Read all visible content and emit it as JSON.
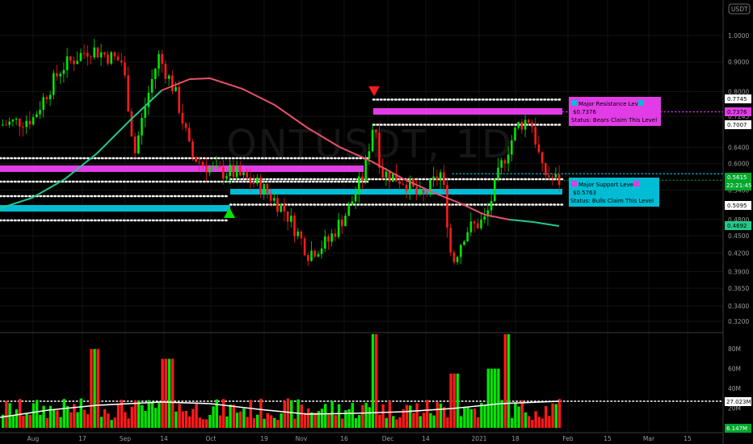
{
  "chart": {
    "currency": "USDT",
    "watermark": "ONTUSDT, 1D",
    "colors": {
      "up": "#00e600",
      "down": "#ff1a1a",
      "ma_up": "#22c98b",
      "ma_down": "#e8506a",
      "resistance": "#e23ce6",
      "support": "#00bcd4",
      "volume_avg": "#ffffff"
    },
    "resistance_box": {
      "title": "Major Resistance Level",
      "price": "$0.7376",
      "status": "Status: Bears Claim This Level"
    },
    "support_box": {
      "title": "Major Support Level",
      "price": "$0.5763",
      "status": "Status: Bulls Claim This Level"
    },
    "tags": {
      "r_top": "0.7745",
      "r_mid": "0.7376",
      "r_bot": "0.7007",
      "price": "0.5615",
      "countdown": "22:21:45",
      "s_bot": "0.5095",
      "ma": "0.4692",
      "vol_avg": "27.023M",
      "vol_last": "6.147M"
    }
  },
  "chart_data": {
    "type": "candlestick",
    "title": "",
    "price_axis": {
      "scale": "log",
      "ticks": [
        "1.0000",
        "0.9000",
        "0.8000",
        "0.7245",
        "0.6400",
        "0.6000",
        "0.5400",
        "0.4800",
        "0.4500",
        "0.4200",
        "0.3900",
        "0.3650",
        "0.3400",
        "0.3200"
      ]
    },
    "volume_axis": {
      "ticks": [
        "80M",
        "60M",
        "40M",
        "20M"
      ]
    },
    "time_axis": [
      "Aug",
      "17",
      "Sep",
      "14",
      "Oct",
      "19",
      "Nov",
      "16",
      "Dec",
      "14",
      "2021",
      "18",
      "Feb",
      "15",
      "Mar",
      "15"
    ],
    "levels": [
      {
        "name": "Major Resistance Level",
        "value": 0.7376
      },
      {
        "name": "Major Support Level",
        "value": 0.5763
      }
    ],
    "current_price": 0.5615,
    "moving_average_last": 0.4692,
    "volume_average": "27.023M",
    "markers": [
      {
        "type": "down-triangle",
        "date": "late Nov"
      },
      {
        "type": "up-triangle",
        "date": "early Oct"
      }
    ]
  }
}
